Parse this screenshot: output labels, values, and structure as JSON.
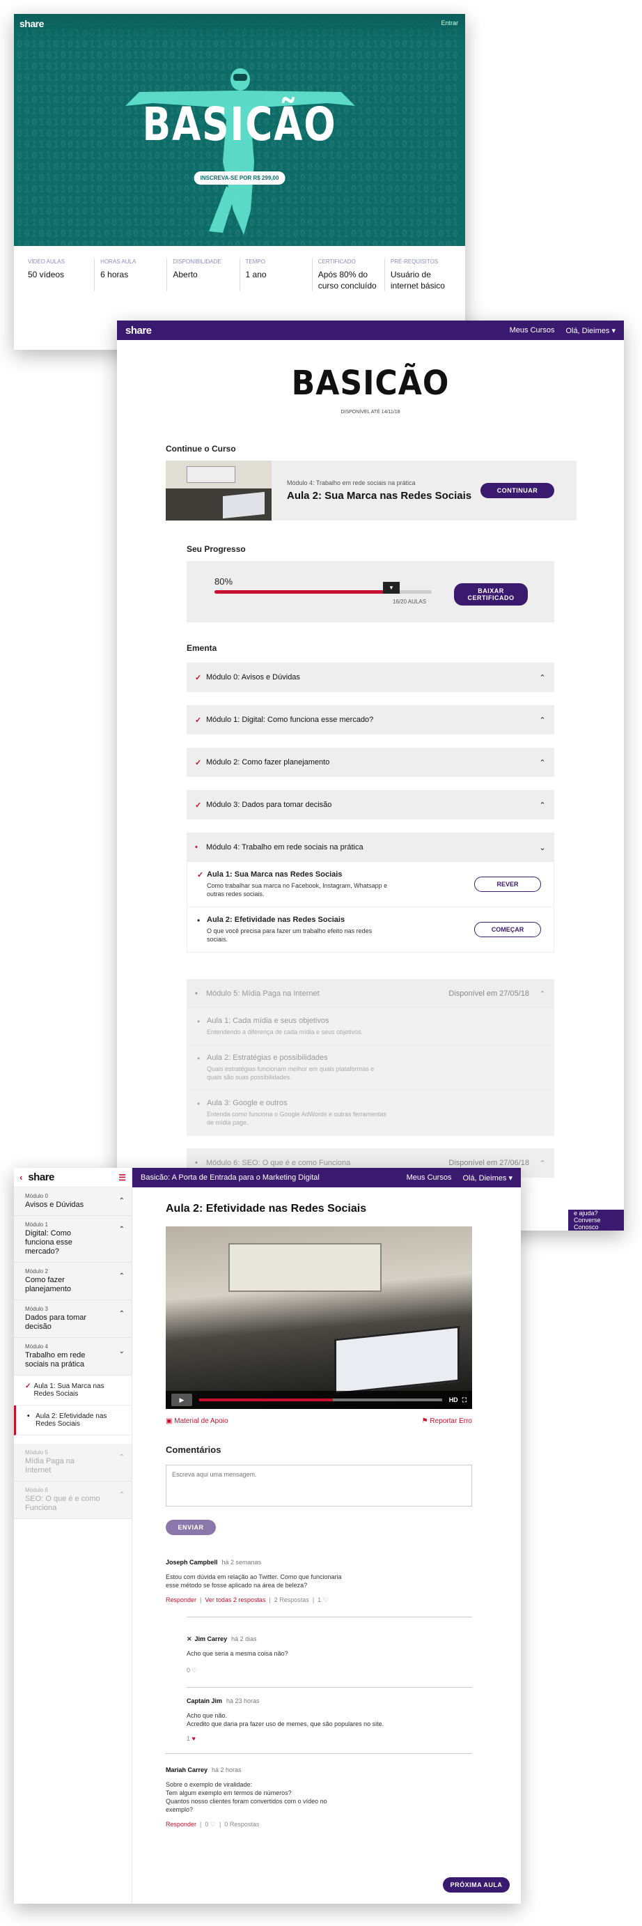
{
  "landing": {
    "logo": "share",
    "enter_link": "Entrar",
    "title": "BASICÃO",
    "signup_pill": "INSCREVA-SE POR R$ 299,00",
    "info": [
      {
        "key": "VÍDEO AULAS",
        "value": "50 vídeos"
      },
      {
        "key": "HORAS AULA",
        "value": "6 horas"
      },
      {
        "key": "DISPONIBILIDADE",
        "value": "Aberto"
      },
      {
        "key": "TEMPO",
        "value": "1 ano"
      },
      {
        "key": "CERTIFICADO",
        "value": "Após 80% do curso concluído"
      },
      {
        "key": "PRÉ-REQUISITOS",
        "value": "Usuário de internet básico"
      }
    ]
  },
  "course": {
    "logo": "share",
    "nav_my_courses": "Meus Cursos",
    "nav_user": "Olá, Dieimes",
    "title": "BASICÃO",
    "available_until": "DISPONÍVEL ATÉ 14/11/18",
    "continue_heading": "Continue o Curso",
    "continue_module": "Módulo 4: Trabalho em rede sociais na prática",
    "continue_lesson": "Aula 2: Sua Marca nas Redes Sociais",
    "continue_button": "CONTINUAR",
    "progress_heading": "Seu Progresso",
    "progress_percent_label": "80%",
    "progress_fraction": 0.8,
    "progress_count": "16/20 AULAS",
    "certificate_button": "BAIXAR CERTIFICADO",
    "ementa_heading": "Ementa",
    "modules": [
      {
        "label": "Módulo 0: Avisos e Dúvidas"
      },
      {
        "label": "Módulo 1: Digital: Como funciona esse mercado?"
      },
      {
        "label": "Módulo 2: Como fazer planejamento"
      },
      {
        "label": "Módulo 3: Dados para tomar decisão"
      },
      {
        "label": "Módulo 4: Trabalho em rede sociais na prática"
      }
    ],
    "module4_lessons": [
      {
        "title": "Aula 1: Sua Marca nas Redes Sociais",
        "desc": "Como trabalhar sua marca no Facebook, Instagram, Whatsapp e outras redes sociais.",
        "button": "REVER"
      },
      {
        "title": "Aula 2:  Efetividade nas Redes Sociais",
        "desc": "O que você precisa para fazer um trabalho efeito nas redes sociais.",
        "button": "COMEÇAR"
      }
    ],
    "module5": {
      "label": "Módulo 5: Mídia Paga na Internet",
      "available": "Disponível em 27/05/18"
    },
    "module5_lessons": [
      {
        "title": "Aula 1: Cada mídia e seus objetivos",
        "desc": "Entendendo a diferença de cada mídia e seus objetivos."
      },
      {
        "title": "Aula 2:  Estratégias e possibilidades",
        "desc": "Quais estratégias funcionam melhor em quais plataformas e quais são suas possibilidades."
      },
      {
        "title": "Aula 3:  Google e outros",
        "desc": "Entenda como funciona o Google AdWords e outras ferramentas de mídia page."
      }
    ],
    "module6": {
      "label": "Módulo 6: SEO: O que é e como Funciona",
      "available": "Disponível em 27/06/18"
    },
    "help_text": "e ajuda? Converse Conosco"
  },
  "lesson": {
    "logo": "share",
    "topbar_title": "Basicão: A Porta de Entrada para o Marketing Digital",
    "nav_my_courses": "Meus Cursos",
    "nav_user": "Olá, Dieimes",
    "sidebar": [
      {
        "n": "Módulo 0",
        "t": "Avisos e Dúvidas"
      },
      {
        "n": "Módulo 1",
        "t": "Digital: Como funciona esse mercado?"
      },
      {
        "n": "Módulo 2",
        "t": "Como fazer planejamento"
      },
      {
        "n": "Módulo 3",
        "t": "Dados para tomar decisão"
      },
      {
        "n": "Módulo 4",
        "t": "Trabalho em rede sociais na prática"
      }
    ],
    "sidebar_lessons": [
      "Aula 1: Sua Marca nas Redes Sociais",
      "Aula 2: Efetividade nas Redes Sociais"
    ],
    "sidebar_locked": [
      {
        "n": "Módulo 5",
        "t": "Mídia Paga na Internet"
      },
      {
        "n": "Módulo 6",
        "t": "SEO: O que é e como Funciona"
      }
    ],
    "heading": "Aula 2: Efetividade nas Redes Sociais",
    "video_hd": "HD",
    "material_link": "Material de Apoio",
    "report_link": "Reportar Erro",
    "comments_heading": "Comentários",
    "comment_placeholder": "Escreva aqui uma mensagem.",
    "send_button": "ENVIAR",
    "comments": [
      {
        "author": "Joseph Campbell",
        "when": "há 2 semanas",
        "text": "Estou com dúvida em relação ao Twitter. Como que funcionaria esse método se fosse aplicado na área de beleza?",
        "reply": "Responder",
        "see": "Ver todas 2 respostas",
        "count": "2 Respostas",
        "likes": "1"
      },
      {
        "author": "Jim Carrey",
        "when": "há 2 dias",
        "text": "Acho que seria a mesma coisa não?",
        "likes": "0"
      },
      {
        "author": "Captain Jim",
        "when": "há 23 horas",
        "text": "Acho que não.\nAcredito que daria pra fazer uso de memes, que são populares no site.",
        "likes": "1"
      },
      {
        "author": "Mariah Carrey",
        "when": "há 2 horas",
        "text": "Sobre o exemplo de viralidade:\nTem algum exemplo em termos de números?\nQuantos nosso clientes foram convertidos com o vídeo no exemplo?",
        "reply": "Responder",
        "likes": "0",
        "count": "0 Respostas"
      }
    ],
    "next_button": "PRÓXIMA AULA"
  }
}
